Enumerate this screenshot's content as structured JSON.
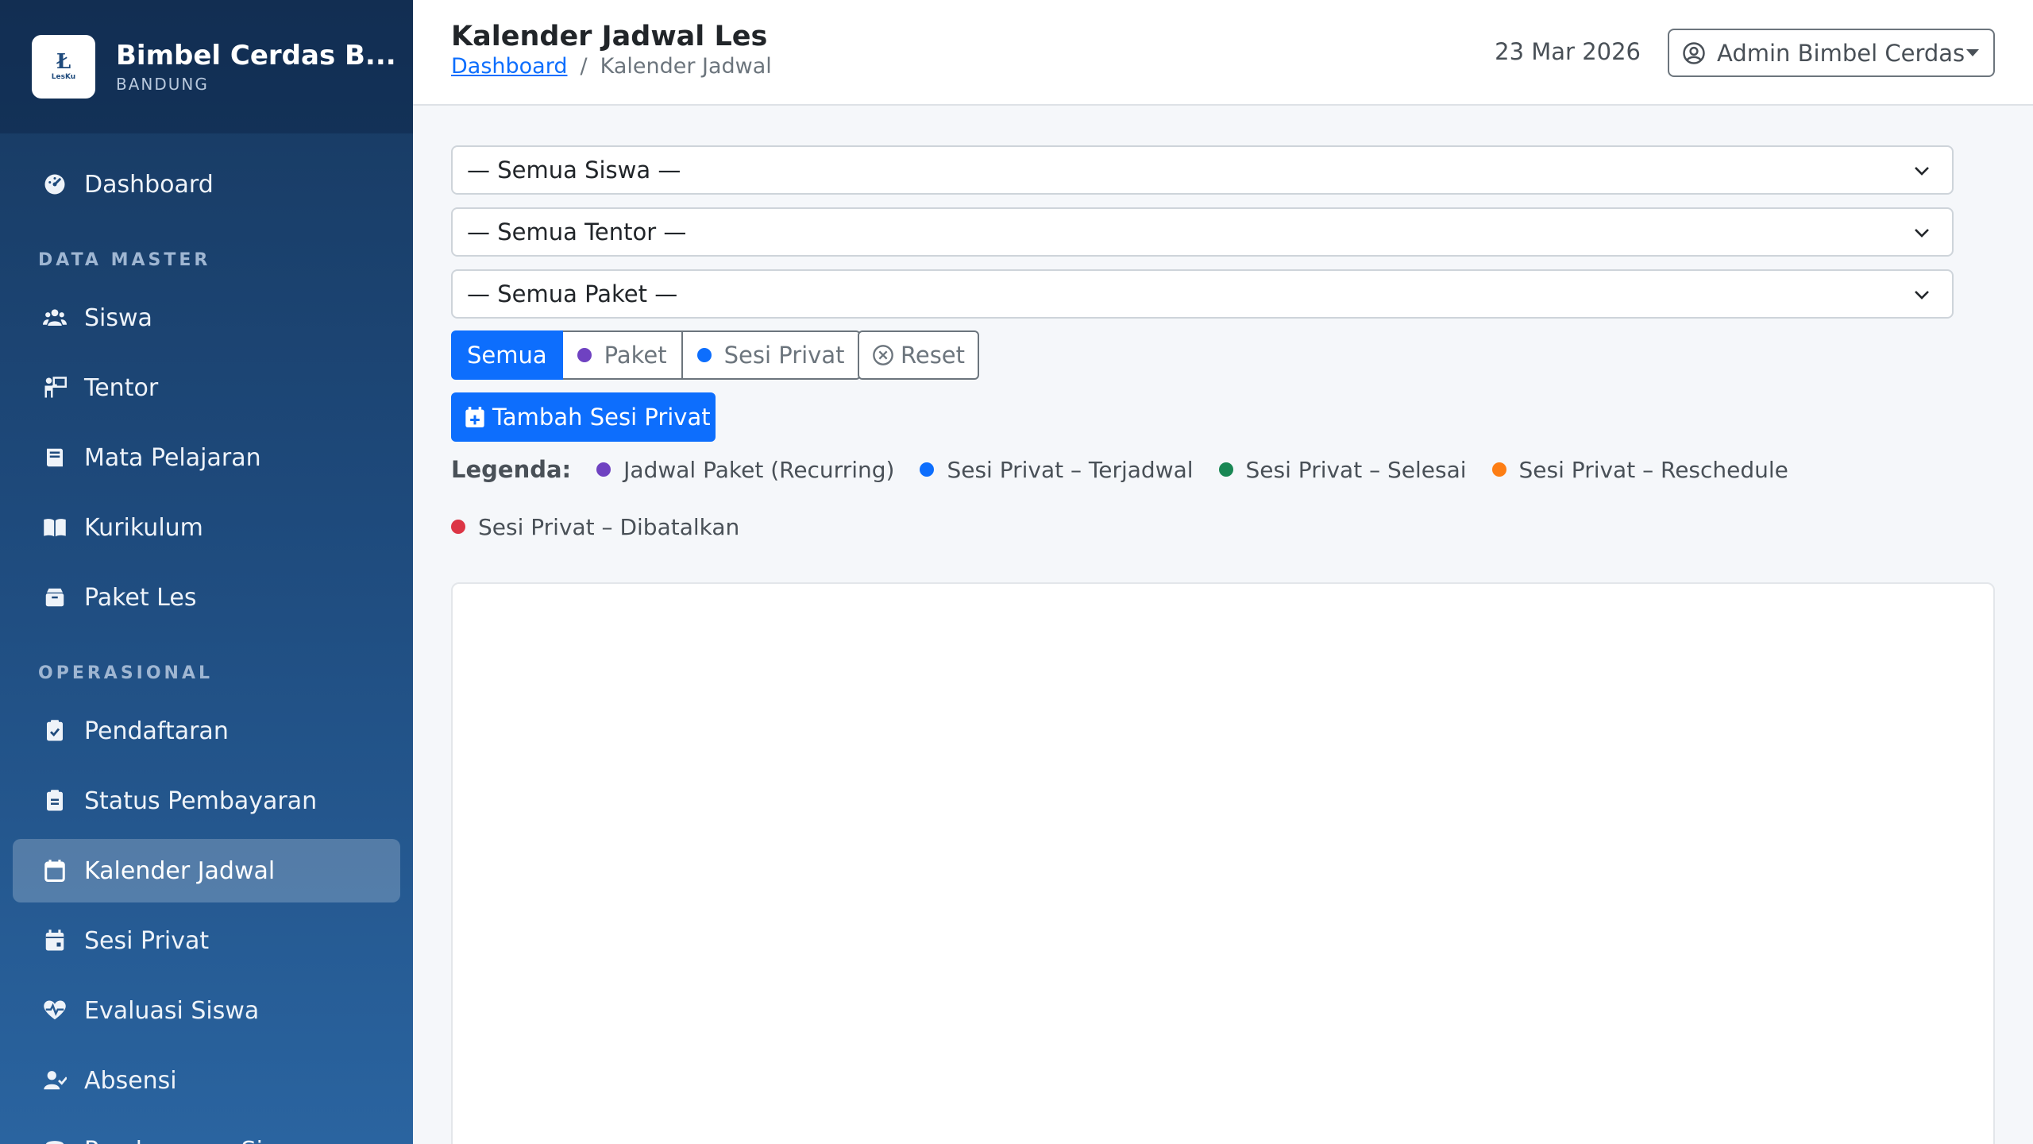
{
  "brand": {
    "name": "Bimbel Cerdas B...",
    "city": "BANDUNG",
    "logo_text": "LesKu"
  },
  "sidebar": {
    "dashboard": "Dashboard",
    "section_master": "DATA MASTER",
    "siswa": "Siswa",
    "tentor": "Tentor",
    "mapel": "Mata Pelajaran",
    "kurikulum": "Kurikulum",
    "paket": "Paket Les",
    "section_ops": "OPERASIONAL",
    "pendaftaran": "Pendaftaran",
    "status_pembayaran": "Status Pembayaran",
    "kalender": "Kalender Jadwal",
    "sesi_privat": "Sesi Privat",
    "evaluasi": "Evaluasi Siswa",
    "absensi": "Absensi",
    "pembayaran_siswa": "Pembayaran Siswa"
  },
  "header": {
    "title": "Kalender Jadwal Les",
    "breadcrumb_home": "Dashboard",
    "breadcrumb_sep": "/",
    "breadcrumb_current": "Kalender Jadwal",
    "date": "23 Mar 2026",
    "user": "Admin Bimbel Cerdas"
  },
  "filters": {
    "siswa": "— Semua Siswa —",
    "tentor": "— Semua Tentor —",
    "paket": "— Semua Paket —"
  },
  "toggle": {
    "all": "Semua",
    "paket": "Paket",
    "privat": "Sesi Privat",
    "reset": "Reset"
  },
  "add_button": "Tambah Sesi Privat",
  "legend": {
    "title": "Legenda:",
    "items": [
      "Jadwal Paket (Recurring)",
      "Sesi Privat – Terjadwal",
      "Sesi Privat – Selesai",
      "Sesi Privat – Reschedule",
      "Sesi Privat – Dibatalkan"
    ]
  },
  "colors": {
    "paket": "#6f42c1",
    "terjadwal": "#0d6efd",
    "selesai": "#198754",
    "reschedule": "#fd7e14",
    "dibatalkan": "#dc3545",
    "primary": "#0d6efd"
  }
}
